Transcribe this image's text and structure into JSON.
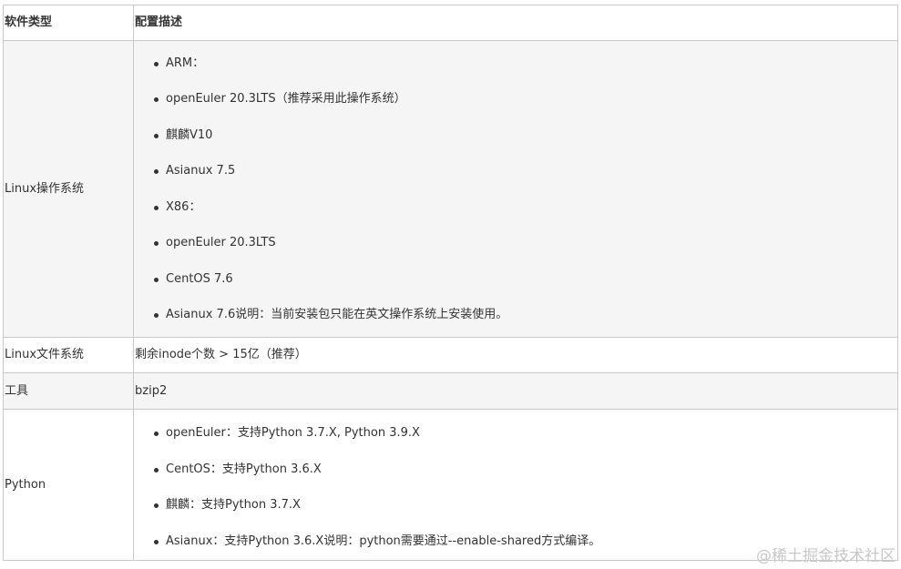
{
  "table": {
    "headers": {
      "type": "软件类型",
      "desc": "配置描述"
    },
    "rows": [
      {
        "type": "Linux操作系统",
        "items": [
          "ARM：",
          "openEuler 20.3LTS（推荐采用此操作系统）",
          "麒麟V10",
          "Asianux 7.5",
          "X86：",
          "openEuler 20.3LTS",
          "CentOS 7.6",
          "Asianux 7.6说明：当前安装包只能在英文操作系统上安装使用。"
        ]
      },
      {
        "type": "Linux文件系统",
        "text": "剩余inode个数 > 15亿（推荐）"
      },
      {
        "type": "工具",
        "text": "bzip2"
      },
      {
        "type": "Python",
        "items": [
          "openEuler：支持Python 3.7.X, Python 3.9.X",
          "CentOS：支持Python 3.6.X",
          "麒麟：支持Python 3.7.X",
          "Asianux：支持Python 3.6.X说明：python需要通过--enable-shared方式编译。"
        ]
      }
    ]
  },
  "watermark": "@稀土掘金技术社区"
}
